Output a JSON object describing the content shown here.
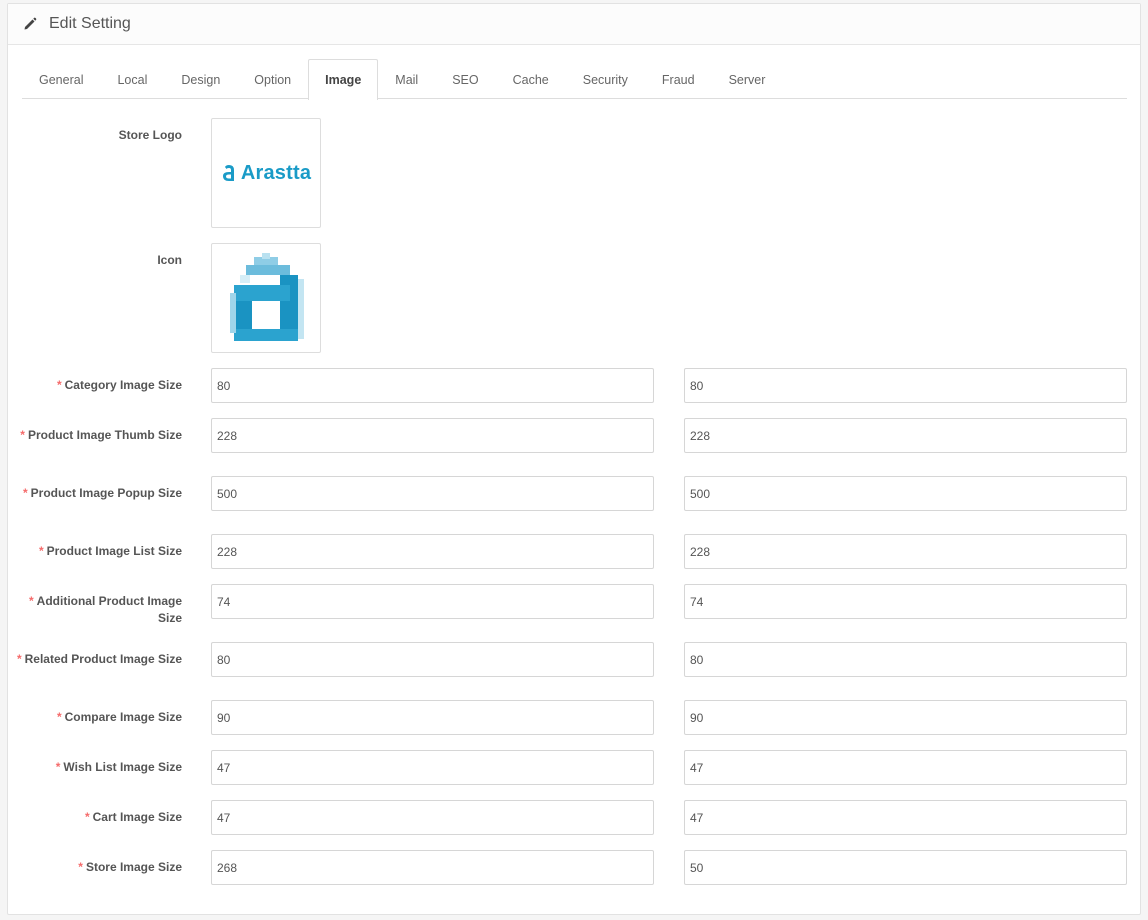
{
  "header": {
    "title": "Edit Setting"
  },
  "tabs": [
    {
      "label": "General"
    },
    {
      "label": "Local"
    },
    {
      "label": "Design"
    },
    {
      "label": "Option"
    },
    {
      "label": "Image",
      "active": true
    },
    {
      "label": "Mail"
    },
    {
      "label": "SEO"
    },
    {
      "label": "Cache"
    },
    {
      "label": "Security"
    },
    {
      "label": "Fraud"
    },
    {
      "label": "Server"
    }
  ],
  "store_logo": {
    "label": "Store Logo",
    "logo_text": "Arastta"
  },
  "icon_field": {
    "label": "Icon"
  },
  "accent_color": "#1a9bc7",
  "required_color": "#f56b6b",
  "fields": [
    {
      "label": "Category Image Size",
      "width": "80",
      "height": "80"
    },
    {
      "label": "Product Image Thumb Size",
      "width": "228",
      "height": "228"
    },
    {
      "label": "Product Image Popup Size",
      "width": "500",
      "height": "500"
    },
    {
      "label": "Product Image List Size",
      "width": "228",
      "height": "228"
    },
    {
      "label": "Additional Product Image Size",
      "width": "74",
      "height": "74"
    },
    {
      "label": "Related Product Image Size",
      "width": "80",
      "height": "80"
    },
    {
      "label": "Compare Image Size",
      "width": "90",
      "height": "90"
    },
    {
      "label": "Wish List Image Size",
      "width": "47",
      "height": "47"
    },
    {
      "label": "Cart Image Size",
      "width": "47",
      "height": "47"
    },
    {
      "label": "Store Image Size",
      "width": "268",
      "height": "50"
    }
  ]
}
